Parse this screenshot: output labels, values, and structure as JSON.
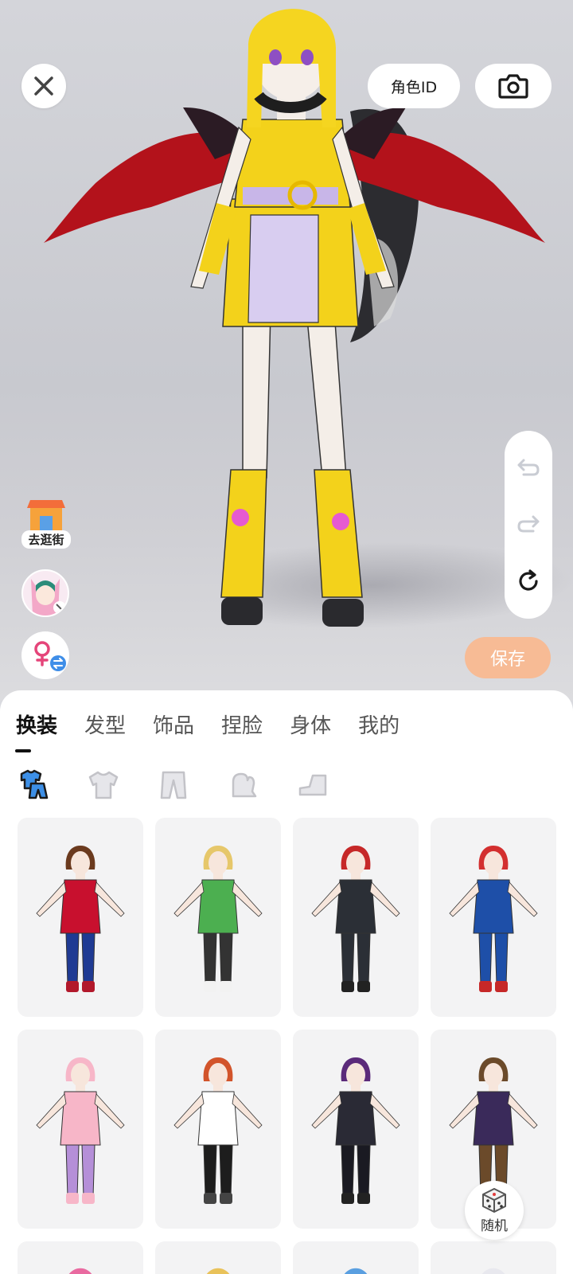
{
  "header": {
    "role_id_label": "角色ID"
  },
  "side": {
    "shop_label": "去逛街"
  },
  "actions": {
    "save_label": "保存",
    "random_label": "随机"
  },
  "tabs": [
    "换装",
    "发型",
    "饰品",
    "捏脸",
    "身体",
    "我的"
  ],
  "subtabs": [
    "outfit-set-icon",
    "top-icon",
    "pants-icon",
    "gloves-icon",
    "shoes-icon"
  ],
  "outfits": [
    {
      "name": "outfit-heroine-red-gold",
      "colors": {
        "top": "#c8102e",
        "bottom": "#1f3a93",
        "hair": "#6b3a1e",
        "boots": "#b2182b"
      }
    },
    {
      "name": "outfit-green-robe",
      "colors": {
        "top": "#4caf50",
        "bottom": "#333",
        "hair": "#e6c76a",
        "boots": "#f2f2f2"
      }
    },
    {
      "name": "outfit-black-suit",
      "colors": {
        "top": "#2b2f36",
        "bottom": "#2b2f36",
        "hair": "#c62828",
        "boots": "#222"
      }
    },
    {
      "name": "outfit-blue-red-hero",
      "colors": {
        "top": "#1e4fa8",
        "bottom": "#1e4fa8",
        "hair": "#d32f2f",
        "boots": "#c62828"
      }
    },
    {
      "name": "outfit-pink-cat",
      "colors": {
        "top": "#f7b6c8",
        "bottom": "#b58fd8",
        "hair": "#f7b6c8",
        "boots": "#f7b6c8"
      }
    },
    {
      "name": "outfit-casual-tee",
      "colors": {
        "top": "#ffffff",
        "bottom": "#1d1d1d",
        "hair": "#d2542b",
        "boots": "#444"
      }
    },
    {
      "name": "outfit-gothic-dress",
      "colors": {
        "top": "#2a2a35",
        "bottom": "#1a1a22",
        "hair": "#5b2a7a",
        "boots": "#222"
      }
    },
    {
      "name": "outfit-school-robe",
      "colors": {
        "top": "#3a2a5a",
        "bottom": "#6b4a2a",
        "hair": "#6b4a2a",
        "boots": "#2a1a1a"
      }
    }
  ],
  "peek_outfits": [
    "outfit-pink-hair",
    "outfit-blonde-spiky",
    "outfit-blue-hair",
    "outfit-white-hair"
  ]
}
